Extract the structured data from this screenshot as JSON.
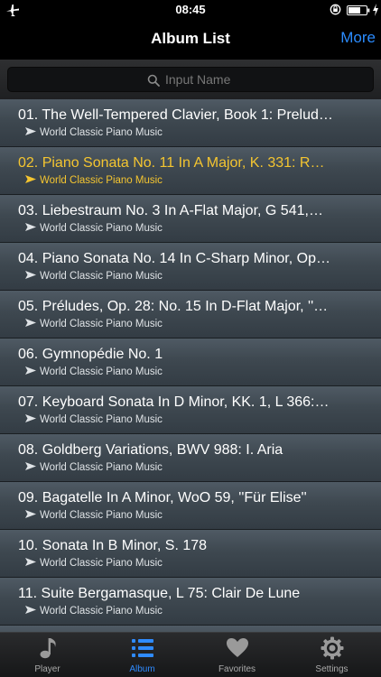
{
  "status": {
    "time": "08:45"
  },
  "nav": {
    "title": "Album List",
    "more_label": "More"
  },
  "search": {
    "placeholder": "Input Name",
    "value": ""
  },
  "list": {
    "active_index": 1,
    "items": [
      {
        "title": "01. The Well-Tempered Clavier, Book 1: Prelud…",
        "subtitle": "World Classic Piano Music"
      },
      {
        "title": "02. Piano Sonata No. 11 In A Major, K. 331: R…",
        "subtitle": "World Classic Piano Music"
      },
      {
        "title": "03. Liebestraum No. 3 In A-Flat Major, G 541,…",
        "subtitle": "World Classic Piano Music"
      },
      {
        "title": "04. Piano Sonata No. 14 In C-Sharp Minor, Op…",
        "subtitle": "World Classic Piano Music"
      },
      {
        "title": "05. Préludes, Op. 28: No. 15 In D-Flat Major, ''…",
        "subtitle": "World Classic Piano Music"
      },
      {
        "title": "06. Gymnopédie No. 1",
        "subtitle": "World Classic Piano Music"
      },
      {
        "title": "07. Keyboard Sonata In D Minor, KK. 1, L 366:…",
        "subtitle": "World Classic Piano Music"
      },
      {
        "title": "08. Goldberg Variations, BWV 988: I. Aria",
        "subtitle": "World Classic Piano Music"
      },
      {
        "title": "09. Bagatelle In A Minor, WoO 59, ''Für Elise''",
        "subtitle": "World Classic Piano Music"
      },
      {
        "title": "10. Sonata In B Minor, S. 178",
        "subtitle": "World Classic Piano Music"
      },
      {
        "title": "11. Suite Bergamasque, L 75: Clair De Lune",
        "subtitle": "World Classic Piano Music"
      }
    ]
  },
  "tabs": [
    {
      "label": "Player",
      "icon": "music-note-icon"
    },
    {
      "label": "Album",
      "icon": "list-icon"
    },
    {
      "label": "Favorites",
      "icon": "heart-icon"
    },
    {
      "label": "Settings",
      "icon": "gear-icon"
    }
  ],
  "selected_tab": 1,
  "colors": {
    "accent": "#2f8bff",
    "active_row_text": "#f4c530",
    "more_link": "#2b8cff"
  }
}
